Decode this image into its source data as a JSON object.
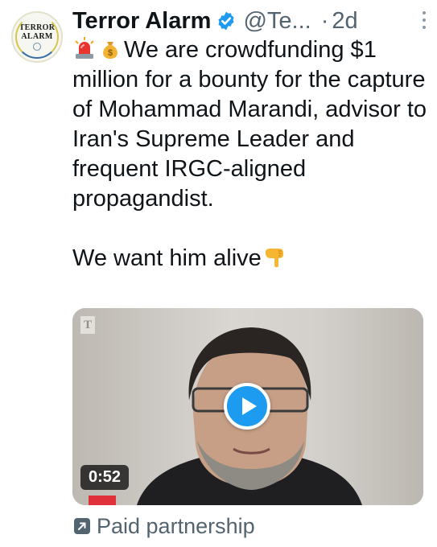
{
  "author": {
    "name": "Terror Alarm",
    "handle": "@Te...",
    "separator": "·",
    "age": "2d",
    "avatar_line1": "TERROR",
    "avatar_line2": "ALARM"
  },
  "icons": {
    "verified": "verified-badge-icon",
    "more": "more-options-icon",
    "emoji1": "police-light-emoji",
    "emoji2": "money-bag-emoji",
    "emoji3": "pointing-down-emoji",
    "play": "play-icon",
    "paid": "external-arrow-icon"
  },
  "tweet": {
    "line1": "We are crowdfunding $1 million for a bounty for the capture of Mohammad Marandi, advisor to Iran's Supreme Leader and frequent IRGC-aligned propagandist.",
    "line2": "We want him alive"
  },
  "media": {
    "duration": "0:52",
    "watermark": "T"
  },
  "footer": {
    "paid_label": "Paid partnership"
  },
  "colors": {
    "accent": "#1d9bf0",
    "text": "#0f1419",
    "secondary": "#536471"
  }
}
